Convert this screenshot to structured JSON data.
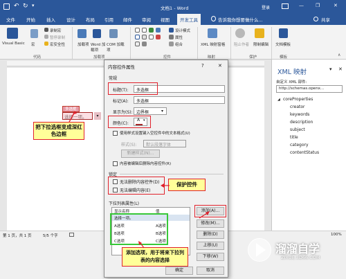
{
  "titlebar": {
    "doc_title": "文档1 - Word",
    "user": "登录",
    "minimize": "—",
    "restore": "❐",
    "close": "✕"
  },
  "tabs": [
    "文件",
    "开始",
    "插入",
    "设计",
    "布局",
    "引用",
    "邮件",
    "审阅",
    "视图",
    "开发工具"
  ],
  "tell_me": "告诉我你想要做什么...",
  "share": "共享",
  "ribbon": {
    "visual_basic": "Visual Basic",
    "macros": "宏",
    "record_macro": "录制宏",
    "pause_macro": "暂停录制",
    "macro_security": "宏安全性",
    "group_code": "代码",
    "addins": "加载项",
    "word_addins": "Word 加载项",
    "com_addins": "COM 加载项",
    "group_addins": "加载项",
    "design_mode": "设计模式",
    "properties": "属性",
    "group_ctrl": "组合",
    "group_controls": "控件",
    "xml_mapping": "XML 映射窗格",
    "group_mapping": "映射",
    "block_authors": "阻止作者",
    "restrict_editing": "限制编辑",
    "group_protect": "保护",
    "doc_template": "文档模板",
    "group_templates": "模板"
  },
  "document": {
    "control_title": "多选框",
    "placeholder": "选择一项。",
    "note1": "把下拉选框变成深红色边框"
  },
  "xml_pane": {
    "title": "XML 映射",
    "custom_part_label": "自定义 XML 部件:",
    "custom_part_value": "http://schemas.openx...",
    "root": "coreProperties",
    "nodes": [
      "creator",
      "keywords",
      "description",
      "subject",
      "title",
      "category",
      "contentStatus"
    ]
  },
  "dialog": {
    "title": "内容控件属性",
    "help": "?",
    "close": "✕",
    "section_general": "常规",
    "title_label": "标题(T):",
    "title_value": "多选框",
    "tag_label": "标记(A):",
    "tag_value": "多选框",
    "show_as_label": "显示为(S):",
    "show_as_value": "边界框",
    "color_label": "颜色(C):",
    "use_style": "使用样式设置键入空控件中的文本格式(U)",
    "style_label": "样式(S):",
    "style_value": "默认段落字体",
    "new_style": "新建样式(N)...",
    "remove_when_edited": "内容被编辑后删除内容控件(R)",
    "section_lock": "锁定",
    "no_delete": "无法删除内容控件(D)",
    "no_edit": "无法编辑内容(E)",
    "section_list": "下拉列表属性(L)",
    "col_display": "显示名称",
    "col_value": "值",
    "list": [
      {
        "name": "选择一项。",
        "value": ""
      },
      {
        "name": "A选项",
        "value": "A选项"
      },
      {
        "name": "B选项",
        "value": "B选项"
      },
      {
        "name": "C选项",
        "value": "C选项"
      }
    ],
    "btn_add": "添加(A)...",
    "btn_modify": "修改(M)...",
    "btn_delete": "删除(D)",
    "btn_up": "上移(U)",
    "btn_down": "下移(W)",
    "btn_ok": "确定",
    "btn_cancel": "取消"
  },
  "annotations": {
    "note_lock": "保护控件",
    "note_list": "添加选项，用于将来下拉列表的内容选择"
  },
  "status": {
    "page": "第 1 页，共 1 页",
    "words": "5/5 个字",
    "zoom": "100%"
  },
  "watermark": {
    "brand": "溜溜自学",
    "url": "ZIXUE.3D66.COM"
  },
  "colors": {
    "word_blue": "#2b579a",
    "annotation_red": "#e0212b",
    "highlight_green": "#37c837",
    "note_yellow": "#ffff99"
  }
}
